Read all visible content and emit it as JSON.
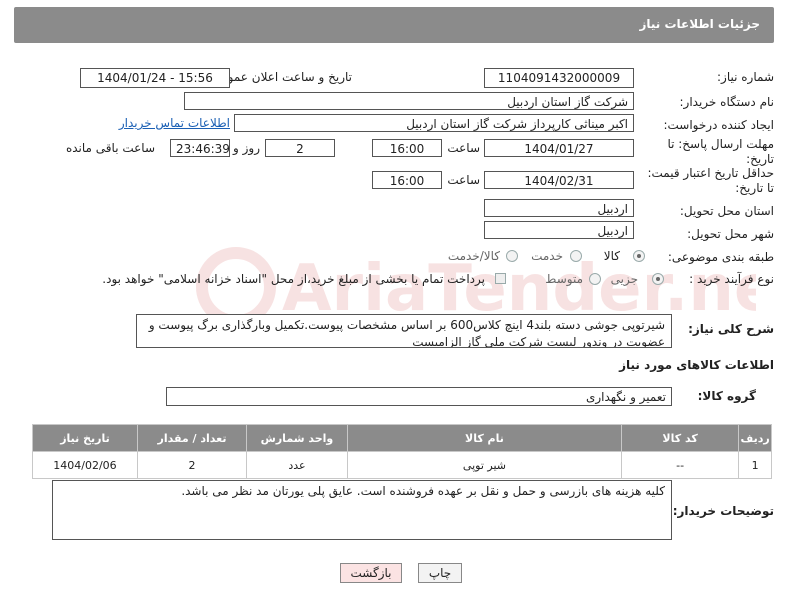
{
  "header": {
    "title": "جزئیات اطلاعات نیاز"
  },
  "form": {
    "need_number_label": "شماره نیاز:",
    "need_number": "1104091432000009",
    "announce_label": "تاریخ و ساعت اعلان عمومی:",
    "announce_value": "1404/01/24 - 15:56",
    "buyer_org_label": "نام دستگاه خریدار:",
    "buyer_org": "شرکت گاز استان اردبیل",
    "creator_label": "ایجاد کننده درخواست:",
    "creator": "اکبر میناثی کارپرداز شرکت گاز استان اردبیل",
    "buyer_contact_link": "اطلاعات تماس خریدار",
    "deadline_label": "مهلت ارسال پاسخ: تا تاریخ:",
    "deadline_date": "1404/01/27",
    "hour_label": "ساعت",
    "deadline_time": "16:00",
    "days_value": "2",
    "days_label": "روز و",
    "remaining_time": "23:46:39",
    "remaining_label": "ساعت باقی مانده",
    "price_validity_label": "حداقل تاریخ اعتبار قیمت: تا تاریخ:",
    "price_validity_date": "1404/02/31",
    "price_validity_time": "16:00",
    "province_label": "استان محل تحویل:",
    "province": "اردبیل",
    "city_label": "شهر محل تحویل:",
    "city": "اردبیل",
    "category_label": "طبقه بندی موضوعی:",
    "category_options": [
      "کالا",
      "خدمت",
      "کالا/خدمت"
    ],
    "process_label": "نوع فرآیند خرید :",
    "process_options": [
      "جزیی",
      "متوسط"
    ],
    "payment_note": "پرداخت تمام یا بخشی از مبلغ خرید،از محل \"اسناد خزانه اسلامی\" خواهد بود.",
    "description_label": "شرح کلی نیاز:",
    "description": "شیرتوپی جوشی دسته بلند4 اینچ کلاس600 بر اساس مشخصات پیوست.تکمیل وبارگذاری برگ پیوست و عضویت در وندور لیست شرکت ملی گاز الزامیست"
  },
  "goods": {
    "section_title": "اطلاعات کالاهای مورد نیاز",
    "group_label": "گروه کالا:",
    "group_value": "تعمیر و نگهداری",
    "columns": [
      "ردیف",
      "کد کالا",
      "نام کالا",
      "واحد شمارش",
      "تعداد / مقدار",
      "تاریخ نیاز"
    ],
    "rows": [
      [
        "1",
        "--",
        "شیر توپی",
        "عدد",
        "2",
        "1404/02/06"
      ]
    ]
  },
  "buyer_notes": {
    "label": "توضیحات خریدار:",
    "text": "کلیه هزینه های بازرسی و حمل و نقل بر عهده فروشنده است. عایق پلی یورتان مد نظر می باشد."
  },
  "buttons": {
    "print": "چاپ",
    "back": "بازگشت"
  },
  "watermark_text": "AriaTender.neT",
  "colors": {
    "header_bg": "#8b8b8b",
    "link": "#1a5fb4",
    "back_bg": "#fbe3e3",
    "watermark": "#c62828"
  }
}
